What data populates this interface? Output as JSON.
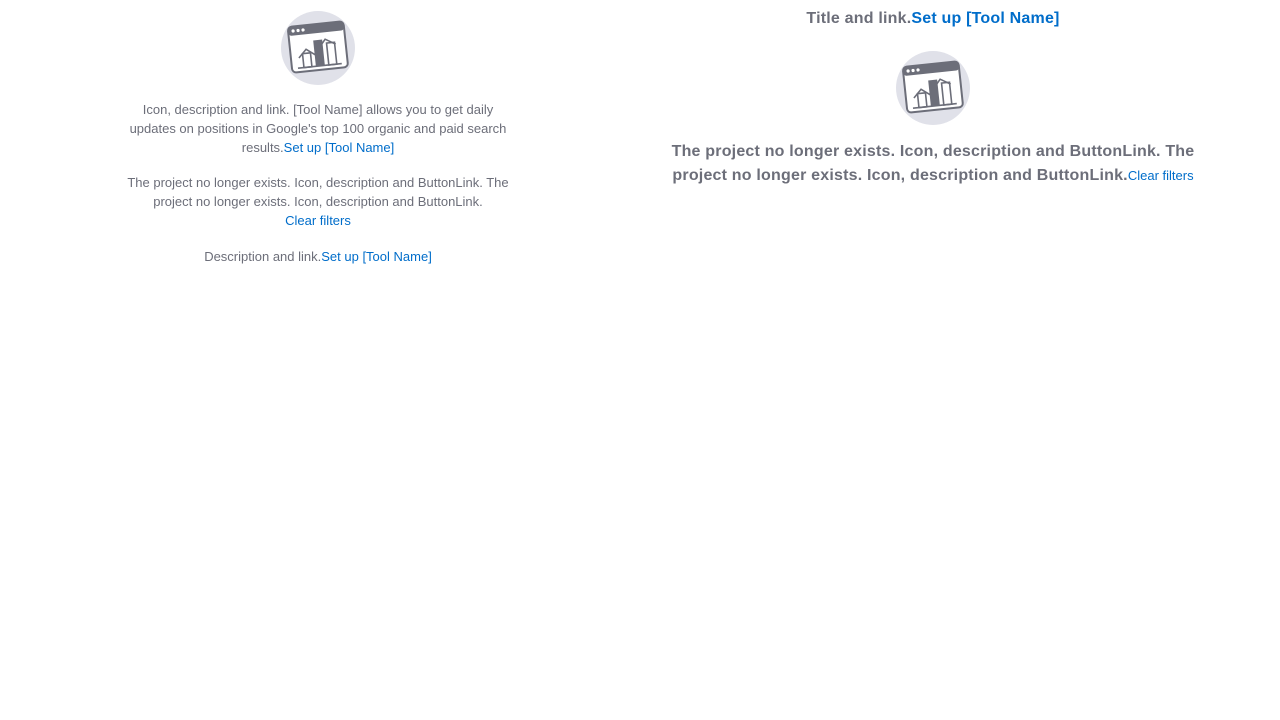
{
  "left": {
    "illustration_icon": "browser-chart-illustration-icon",
    "block1": {
      "text": "Icon, description and link. [Tool Name] allows you to get daily updates on positions in Google's top 100 organic and paid search results.",
      "link": "Set up [Tool Name]"
    },
    "block2": {
      "text": "The project no longer exists. Icon, description and ButtonLink. The project no longer exists. Icon, description and ButtonLink.",
      "link": "Clear filters"
    },
    "block3": {
      "text": "Description and link.",
      "link": "Set up [Tool Name]"
    }
  },
  "right": {
    "title": {
      "text": "Title and link.",
      "link": "Set up [Tool Name]"
    },
    "illustration_icon": "browser-chart-illustration-icon",
    "block": {
      "text": "The project no longer exists. Icon, description and ButtonLink. The project no longer exists. Icon, description and ButtonLink.",
      "link": "Clear filters"
    }
  },
  "colors": {
    "text": "#6c6e79",
    "link": "#006dca",
    "illustration_bg": "#e0e1e9",
    "illustration_stroke": "#6c6e79"
  }
}
